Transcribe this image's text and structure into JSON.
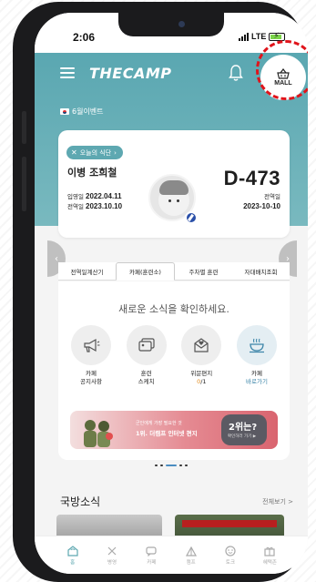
{
  "status_bar": {
    "time": "2:06",
    "network": "LTE"
  },
  "header": {
    "logo": "THECAMP",
    "mall_label": "MALL",
    "event_label": "6월이벤트"
  },
  "soldier_card": {
    "meal_pill": "오늘의 식단",
    "name": "이병 조희철",
    "enlist_label": "입영일",
    "enlist_date": "2022.04.11",
    "discharge_label_left": "전역일",
    "discharge_date_left": "2023.10.10",
    "dday": "D-473",
    "discharge_label_right": "전역일",
    "discharge_date_right": "2023-10-10"
  },
  "tabs": [
    {
      "label": "전역일계산기"
    },
    {
      "label": "카페(훈련소)"
    },
    {
      "label": "주차별 훈련"
    },
    {
      "label": "자대배치조회"
    }
  ],
  "panel": {
    "title": "새로운 소식을 확인하세요.",
    "items": [
      {
        "line1": "카페",
        "line2": "공지사항"
      },
      {
        "line1": "훈련",
        "line2": "스케치"
      },
      {
        "line1": "위문편지",
        "line2_count": "0",
        "line2_total": "/1"
      },
      {
        "line1": "카페",
        "line2": "바로가기"
      }
    ]
  },
  "banner": {
    "line1": "군인에게 가장 필요한 것",
    "line2": "1위. 더캠프 인터넷 편지",
    "q_title": "2위는?",
    "q_sub": "확인하러 가기 ▶"
  },
  "news": {
    "title": "국방소식",
    "more": "전체보기 >"
  },
  "bottom_nav": [
    {
      "label": "홈",
      "icon": "home-icon"
    },
    {
      "label": "병영",
      "icon": "barracks-icon"
    },
    {
      "label": "카페",
      "icon": "cafe-icon"
    },
    {
      "label": "캠프",
      "icon": "camp-icon"
    },
    {
      "label": "토크",
      "icon": "talk-icon"
    },
    {
      "label": "혜택존",
      "icon": "gift-icon"
    }
  ],
  "colors": {
    "teal": "#5ea8b1",
    "highlight_ring": "#e0141b",
    "dday_text": "#1e1e1e"
  }
}
